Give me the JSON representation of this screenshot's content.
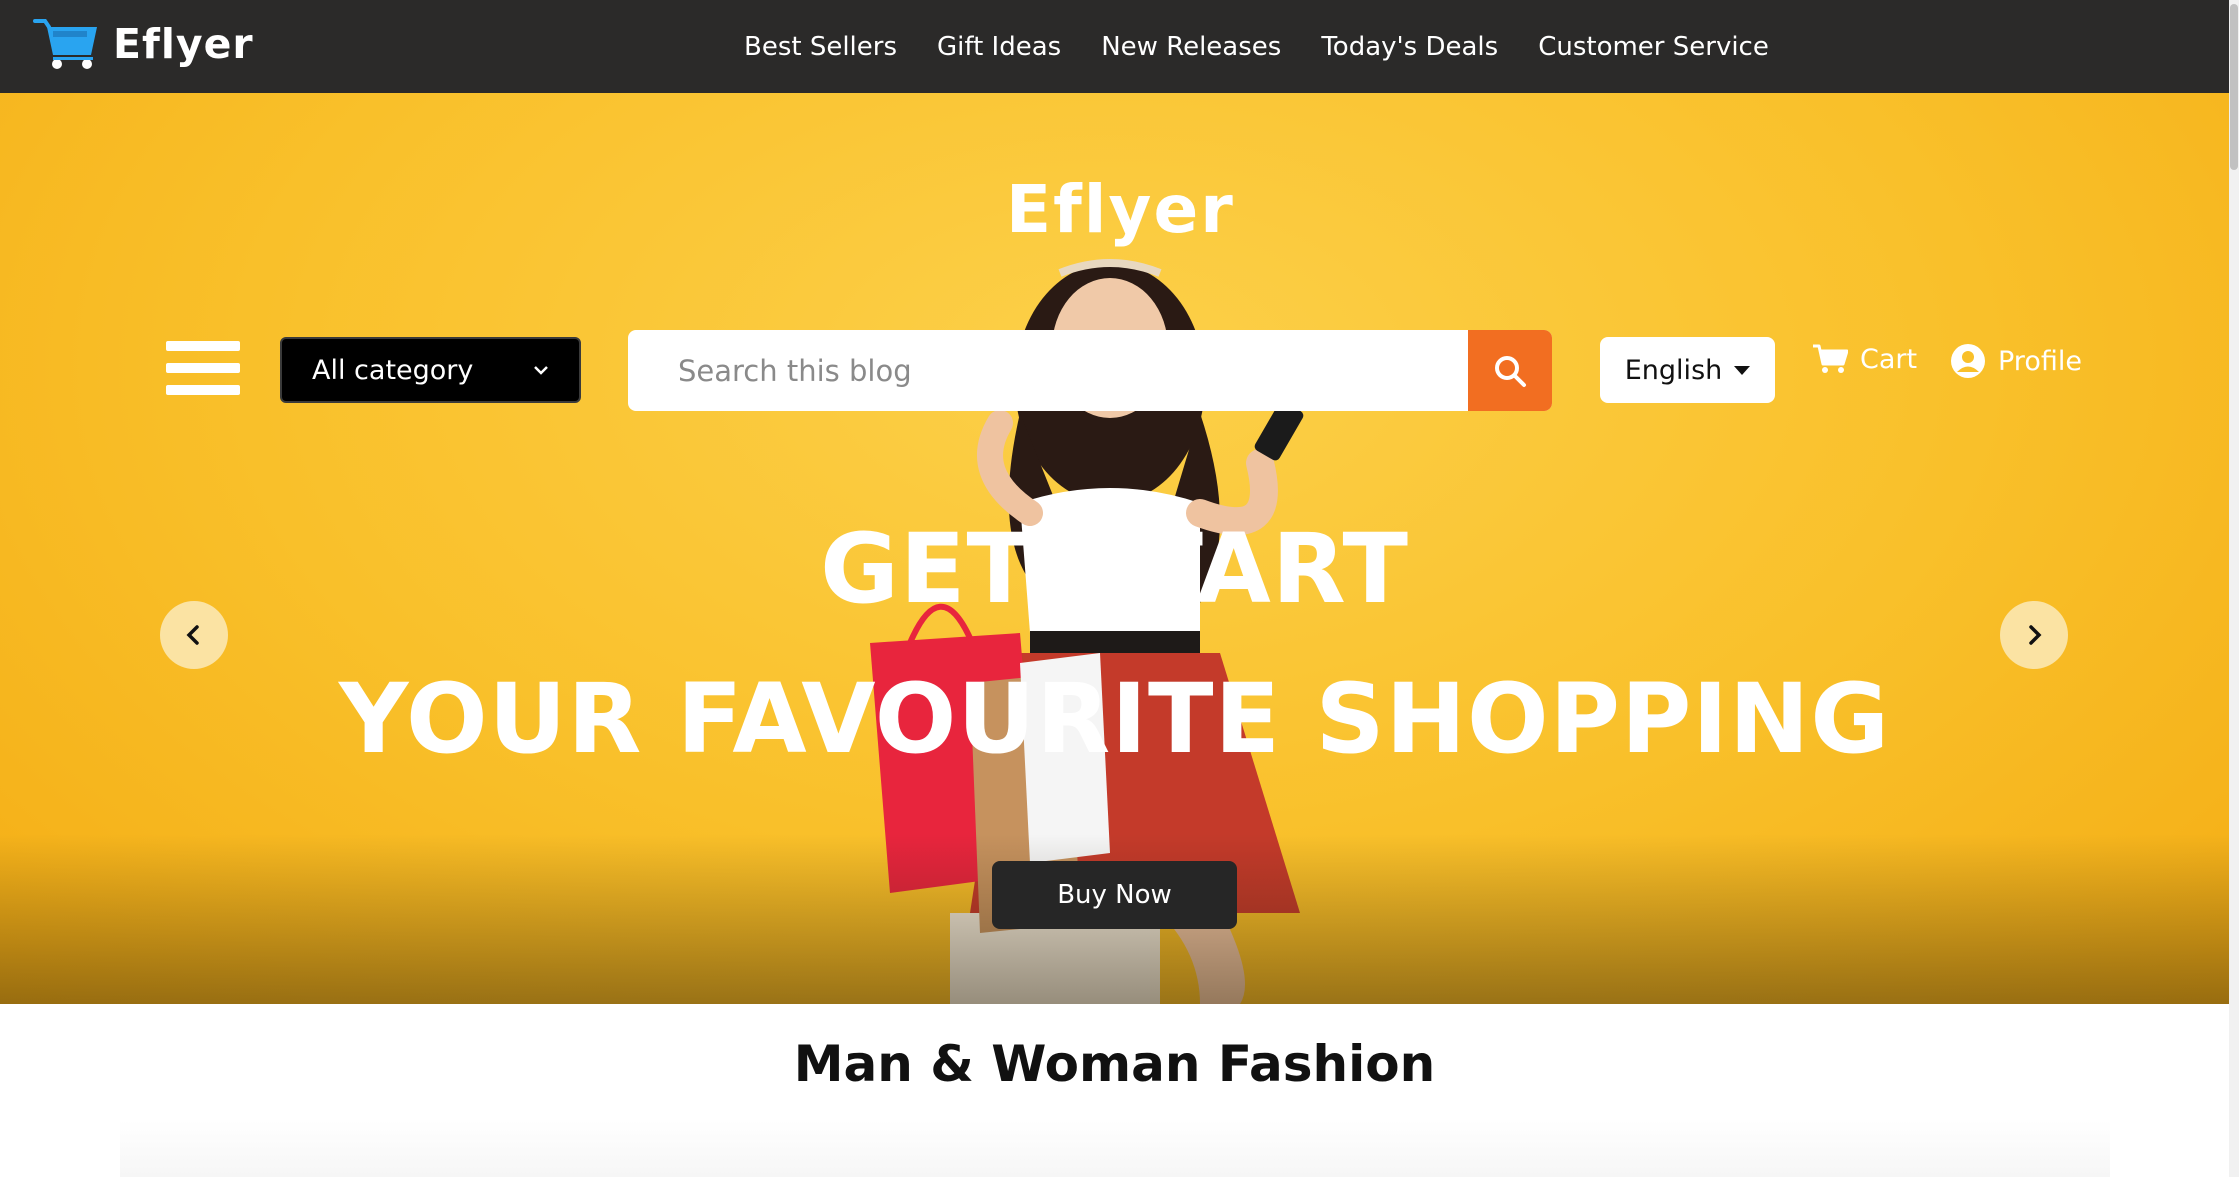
{
  "brand": {
    "name": "Eflyer"
  },
  "nav": {
    "items": [
      "Best Sellers",
      "Gift Ideas",
      "New Releases",
      "Today's Deals",
      "Customer Service"
    ]
  },
  "hero": {
    "logo": "Eflyer",
    "category_selected": "All category",
    "search_placeholder": "Search this blog",
    "language": "English",
    "cart_label": "Cart",
    "profile_label": "Profile",
    "headline_1": "GET START",
    "headline_2": "YOUR FAVOURITE SHOPPING",
    "cta_label": "Buy Now"
  },
  "section": {
    "title": "Man & Woman Fashion"
  },
  "colors": {
    "topbar": "#2b2a29",
    "hero_yellow": "#f9c02a",
    "search_button": "#f26e21",
    "cart_icon_blue": "#29a4f0"
  },
  "icons": [
    "shopping-cart-logo-icon",
    "hamburger-menu-icon",
    "search-icon",
    "caret-down-icon",
    "cart-icon",
    "user-circle-icon",
    "chevron-left-icon",
    "chevron-right-icon"
  ]
}
